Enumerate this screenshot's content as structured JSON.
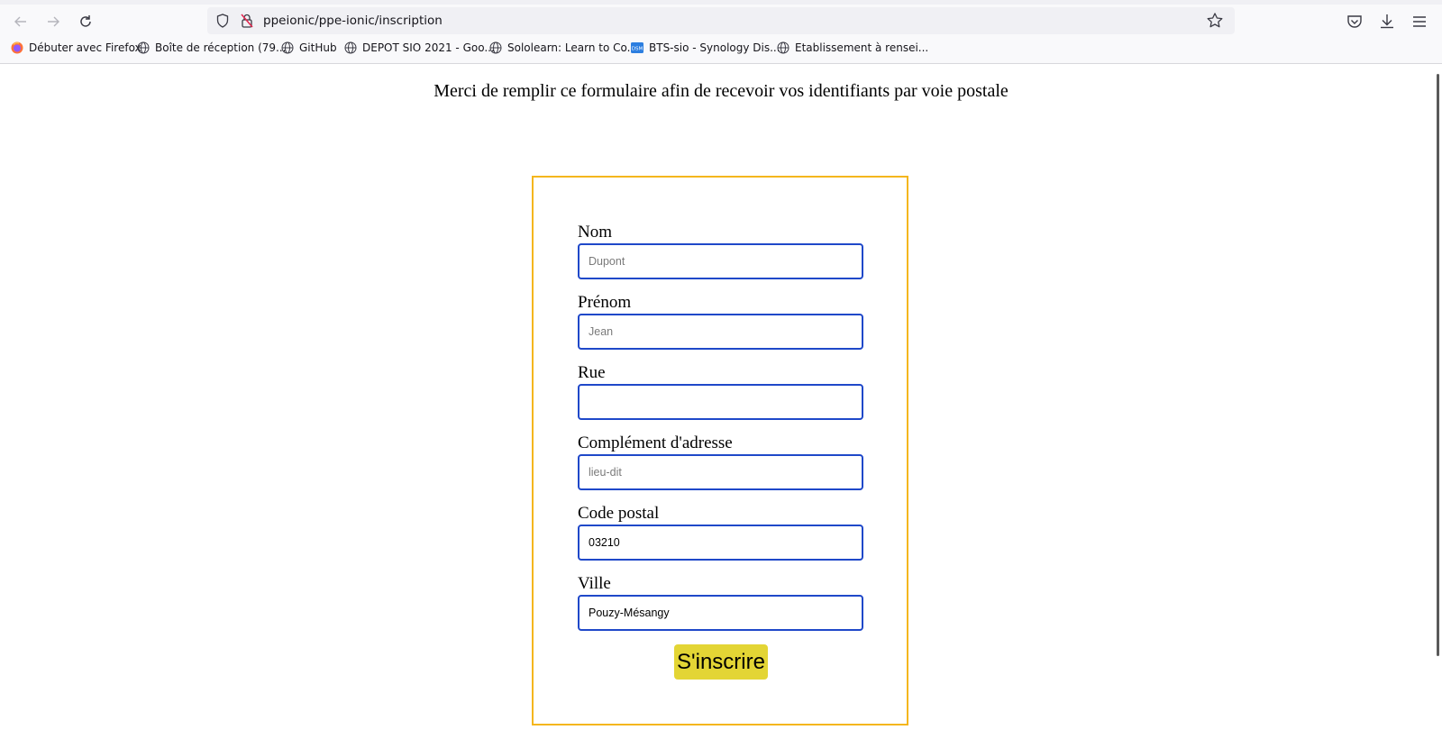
{
  "browser": {
    "url": "ppeionic/ppe-ionic/inscription",
    "bookmarks": [
      {
        "label": "Débuter avec Firefox",
        "icon": "firefox-icon"
      },
      {
        "label": "Boîte de réception (79...",
        "icon": "globe-icon"
      },
      {
        "label": "GitHub",
        "icon": "globe-icon"
      },
      {
        "label": "DEPOT SIO 2021 - Goo...",
        "icon": "globe-icon"
      },
      {
        "label": "Sololearn: Learn to Co...",
        "icon": "globe-icon"
      },
      {
        "label": "BTS-sio - Synology Dis...",
        "icon": "dsm-icon"
      },
      {
        "label": "Etablissement à rensei...",
        "icon": "globe-icon"
      }
    ]
  },
  "page": {
    "intro": "Merci de remplir ce formulaire afin de recevoir vos identifiants par voie postale"
  },
  "form": {
    "nom": {
      "label": "Nom",
      "value": "",
      "placeholder": "Dupont"
    },
    "prenom": {
      "label": "Prénom",
      "value": "",
      "placeholder": "Jean"
    },
    "rue": {
      "label": "Rue",
      "value": "",
      "placeholder": ""
    },
    "complement": {
      "label": "Complément d'adresse",
      "value": "",
      "placeholder": "lieu-dit"
    },
    "code_postal": {
      "label": "Code postal",
      "value": "03210",
      "placeholder": ""
    },
    "ville": {
      "label": "Ville",
      "value": "Pouzy-Mésangy",
      "placeholder": ""
    },
    "submit_label": "S'inscrire"
  },
  "colors": {
    "form_border": "#f4b61d",
    "input_border": "#1f48c9",
    "submit_bg": "#e3d535"
  }
}
